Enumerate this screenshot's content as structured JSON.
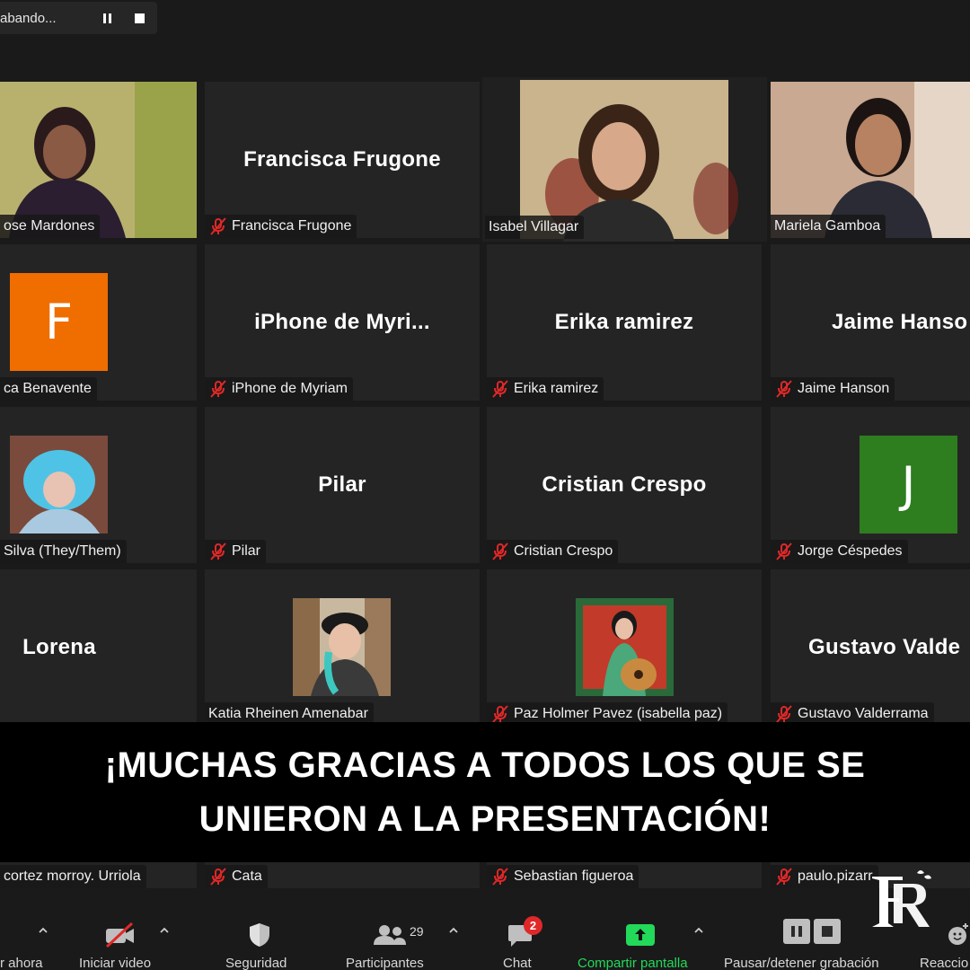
{
  "recording": {
    "status_text": "abando...",
    "pause_label": "pause",
    "stop_label": "stop"
  },
  "tiles": [
    {
      "name": "Rose Mardones",
      "label": "ose Mardones",
      "muted": false,
      "type": "video"
    },
    {
      "name": "Francisca Frugone",
      "label": "Francisca Frugone",
      "muted": true,
      "type": "name"
    },
    {
      "name": "Isabel Villagar",
      "label": "Isabel Villagar",
      "muted": false,
      "type": "video",
      "active": true
    },
    {
      "name": "Mariela Gamboa",
      "label": "Mariela Gamboa",
      "muted": false,
      "type": "video"
    },
    {
      "name": "Benavente",
      "label": "ca Benavente",
      "muted": false,
      "type": "avatar",
      "letter": "F",
      "color": "#f06d00"
    },
    {
      "name": "iPhone de Myri...",
      "label": "iPhone de Myriam",
      "muted": true,
      "type": "name"
    },
    {
      "name": "Erika ramirez",
      "label": "Erika ramirez",
      "muted": true,
      "type": "name"
    },
    {
      "name": "Jaime Hanso",
      "label": "Jaime Hanson",
      "muted": true,
      "type": "name"
    },
    {
      "name": "Silva",
      "label": "Silva (They/Them)",
      "muted": false,
      "type": "photo"
    },
    {
      "name": "Pilar",
      "label": "Pilar",
      "muted": true,
      "type": "name"
    },
    {
      "name": "Cristian Crespo",
      "label": "Cristian Crespo",
      "muted": true,
      "type": "name"
    },
    {
      "name": "Jorge Céspedes",
      "label": "Jorge Céspedes",
      "muted": true,
      "type": "avatar",
      "letter": "J",
      "color": "#2e7d1f"
    },
    {
      "name": "Lorena",
      "label": "",
      "muted": false,
      "type": "name"
    },
    {
      "name": "Katia Rheinen Amenabar",
      "label": "Katia Rheinen Amenabar",
      "muted": false,
      "type": "photo"
    },
    {
      "name": "Paz Holmer Pavez (isabella paz)",
      "label": "Paz Holmer Pavez (isabella paz)",
      "muted": true,
      "type": "photo"
    },
    {
      "name": "Gustavo  Valde",
      "label": "Gustavo Valderrama",
      "muted": true,
      "type": "name"
    }
  ],
  "bottom_row": [
    {
      "label": "cortez morroy. Urriola",
      "muted": false
    },
    {
      "label": "Cata",
      "muted": true
    },
    {
      "label": "Sebastian figueroa",
      "muted": true
    },
    {
      "label": "paulo.pizarr",
      "muted": true
    }
  ],
  "banner": {
    "line1": "¡MUCHAS GRACIAS A TODOS LOS QUE SE",
    "line2": "UNIERON A LA PRESENTACIÓN!"
  },
  "toolbar": {
    "unmute_label": "r ahora",
    "video_label": "Iniciar video",
    "security_label": "Seguridad",
    "participants_label": "Participantes",
    "participants_count": "29",
    "chat_label": "Chat",
    "chat_badge": "2",
    "share_label": "Compartir pantalla",
    "record_label": "Pausar/detener grabación",
    "reactions_label": "Reaccio"
  },
  "colors": {
    "active_border": "#c7e85c",
    "share_green": "#23d959",
    "badge_red": "#e02828",
    "mute_red": "#e02828"
  }
}
